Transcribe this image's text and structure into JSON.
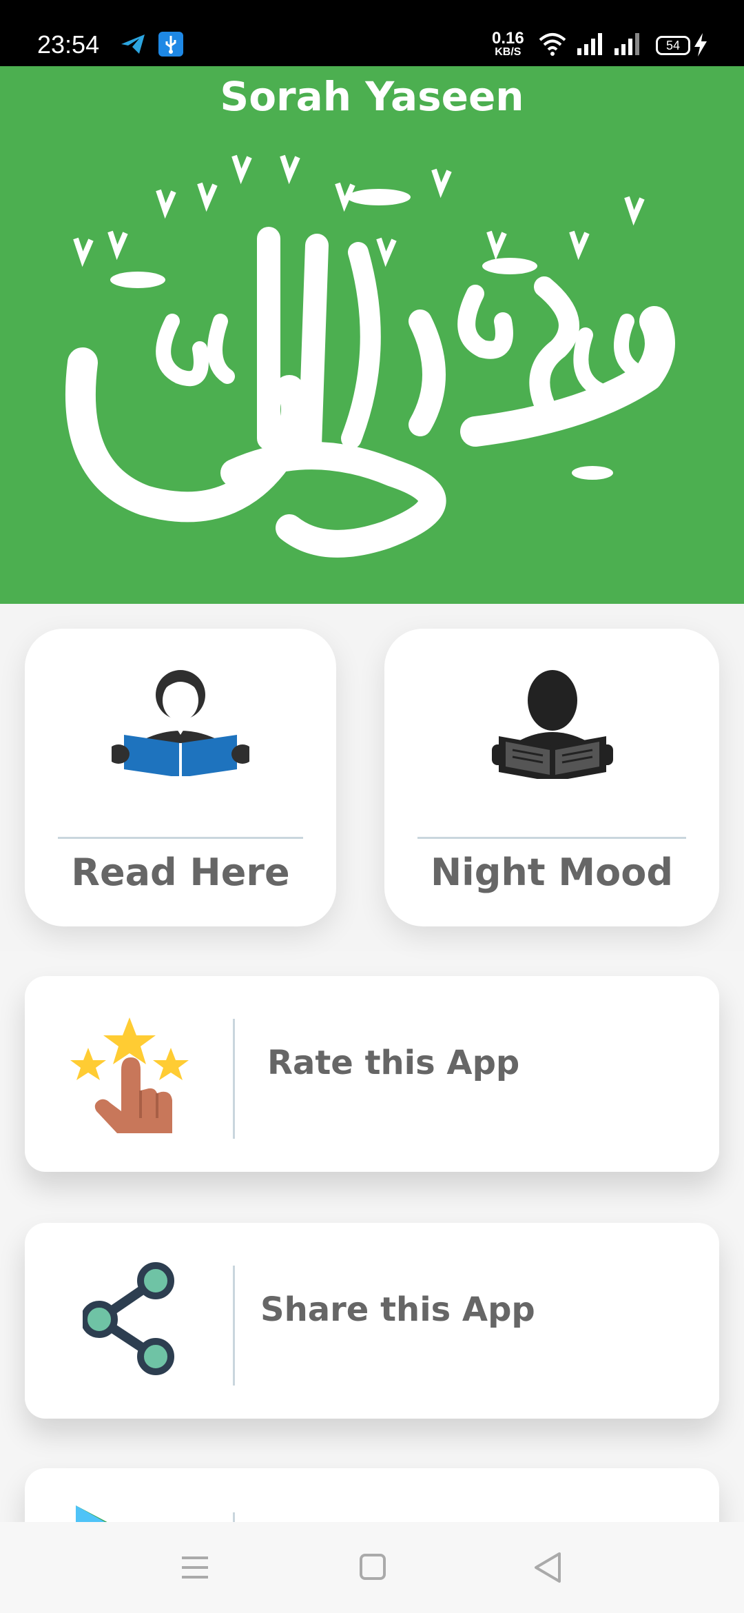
{
  "status_bar": {
    "time": "23:54",
    "network_speed_value": "0.16",
    "network_speed_unit": "KB/S",
    "battery_level": "54",
    "icons": [
      "telegram-icon",
      "usb-icon",
      "wifi-icon",
      "signal-icon",
      "signal-icon",
      "battery-icon",
      "charging-icon"
    ]
  },
  "header": {
    "title": "Sorah Yaseen",
    "calligraphy_alt": "سورة يس",
    "background_color": "#4caf50"
  },
  "tiles": [
    {
      "label": "Read Here",
      "icon": "reader-blue-book-icon"
    },
    {
      "label": "Night Mood",
      "icon": "reader-dark-book-icon"
    }
  ],
  "list": [
    {
      "label": "Rate this App",
      "icon": "rate-stars-hand-icon"
    },
    {
      "label": "Share this App",
      "icon": "share-icon"
    },
    {
      "label": "",
      "icon": "play-store-icon"
    }
  ],
  "nav": {
    "buttons": [
      "menu-icon",
      "home-icon",
      "back-icon"
    ]
  },
  "colors": {
    "label_text": "#666666",
    "divider": "#c9d6dd",
    "reader_book_blue": "#1e73be",
    "share_teal": "#6fc3a5",
    "share_dark": "#2d3e50",
    "star_yellow": "#ffcc33",
    "hand_brown": "#c8775a"
  }
}
